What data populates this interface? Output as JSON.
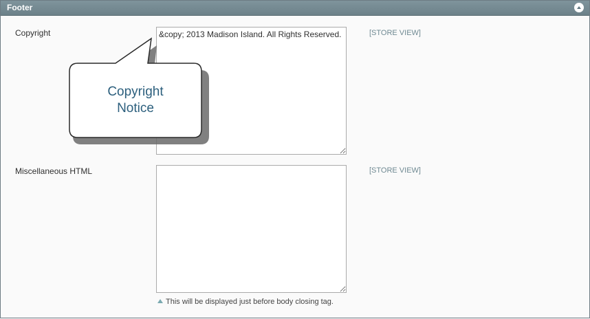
{
  "header": {
    "title": "Footer",
    "collapse_icon": "collapse-up-icon"
  },
  "copyright": {
    "label": "Copyright",
    "value": "&copy; 2013 Madison Island. All Rights Reserved.",
    "scope": "[STORE VIEW]"
  },
  "misc_html": {
    "label": "Miscellaneous HTML",
    "value": "",
    "scope": "[STORE VIEW]",
    "note": "This will be displayed just before body closing tag."
  },
  "callout": {
    "line1": "Copyright",
    "line2": "Notice"
  },
  "colors": {
    "header_bg": "#7a8f97",
    "scope_text": "#6f8992",
    "callout_text": "#2c5f7d"
  }
}
